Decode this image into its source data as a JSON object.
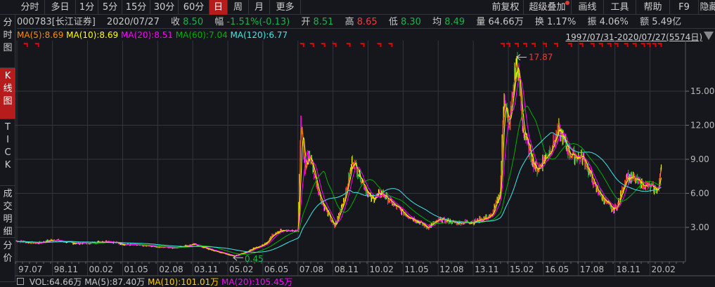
{
  "toolbar": {
    "periods": [
      "分时",
      "多日",
      "1分",
      "5分",
      "15分",
      "30分",
      "60分",
      "日",
      "周",
      "月",
      "更多"
    ],
    "active": "日",
    "right": [
      "前复权",
      "超级叠加",
      "画线",
      "工具",
      "帮助",
      "F9",
      "隐藏"
    ]
  },
  "sidebar": {
    "tabs": [
      "分\n时\n图",
      "K\n线\n图",
      "T\nI\nC\nK",
      "成\n交\n明\n细",
      "分\n价"
    ],
    "active": 1
  },
  "info": {
    "code": "000783[长江证券]",
    "date": "2020/07/27",
    "close_label": "收",
    "close": "8.50",
    "change_label": "幅",
    "change": "-1.51%(-0.13)",
    "open_label": "开",
    "open": "8.51",
    "high_label": "高",
    "high": "8.65",
    "low_label": "低",
    "low": "8.30",
    "avg_label": "均",
    "avg": "8.49",
    "vol_label": "量",
    "vol": "64.66万",
    "turnover_label": "换",
    "turnover": "1.17%",
    "amp_label": "振",
    "amp": "4.06%",
    "amount_label": "额",
    "amount": "5.49亿"
  },
  "ma": {
    "ma5": "MA(5):8.69",
    "ma10": "MA(10):8.69",
    "ma20": "MA(20):8.51",
    "ma60": "MA(60):7.04",
    "ma120": "MA(120):6.77"
  },
  "range": "1997/07/31-2020/07/27(5574日)",
  "vol_row": {
    "vol": "VOL:64.66万",
    "ma5": "MA(5):87.40万",
    "ma10": "MA(10):101.01万",
    "ma20": "MA(20):105.45万"
  },
  "colors": {
    "up": "#f23a3a",
    "down": "#19b34a",
    "ma5": "#ff8c00",
    "ma10": "#ffff00",
    "ma20": "#ff00ff",
    "ma60": "#00b000",
    "ma120": "#40e8e8",
    "accent": "#b71c1c"
  },
  "chart_data": {
    "type": "candlestick",
    "y_ticks": [
      "15.00",
      "12.00",
      "9.00",
      "6.00",
      "3.00"
    ],
    "ylim": [
      0,
      18.5
    ],
    "x_ticks": [
      "97.07",
      "98.11",
      "00.02",
      "01.05",
      "02.08",
      "03.11",
      "05.02",
      "06.05",
      "07.08",
      "08.11",
      "10.02",
      "11.05",
      "12.08",
      "13.11",
      "15.02",
      "16.05",
      "17.08",
      "18.11",
      "20.02"
    ],
    "price_path": [
      [
        1997.55,
        1.8
      ],
      [
        1998.3,
        1.6
      ],
      [
        1998.9,
        1.9
      ],
      [
        1999.6,
        1.6
      ],
      [
        2000.2,
        1.6
      ],
      [
        2000.8,
        1.8
      ],
      [
        2001.4,
        1.5
      ],
      [
        2002.0,
        1.4
      ],
      [
        2002.6,
        1.3
      ],
      [
        2003.2,
        1.2
      ],
      [
        2003.9,
        1.5
      ],
      [
        2004.5,
        1.0
      ],
      [
        2005.1,
        0.6
      ],
      [
        2005.3,
        0.45
      ],
      [
        2005.8,
        0.9
      ],
      [
        2006.4,
        1.5
      ],
      [
        2006.8,
        2.6
      ],
      [
        2007.0,
        2.7
      ],
      [
        2007.6,
        2.7
      ],
      [
        2007.7,
        12.5
      ],
      [
        2007.85,
        8.0
      ],
      [
        2008.0,
        9.5
      ],
      [
        2008.4,
        5.5
      ],
      [
        2008.9,
        3.0
      ],
      [
        2009.3,
        6.0
      ],
      [
        2009.55,
        9.0
      ],
      [
        2009.9,
        7.0
      ],
      [
        2010.2,
        5.5
      ],
      [
        2010.6,
        6.0
      ],
      [
        2011.0,
        5.0
      ],
      [
        2011.4,
        4.2
      ],
      [
        2011.9,
        3.5
      ],
      [
        2012.2,
        3.0
      ],
      [
        2012.7,
        3.7
      ],
      [
        2013.2,
        3.4
      ],
      [
        2013.9,
        3.5
      ],
      [
        2014.5,
        4.0
      ],
      [
        2014.8,
        6.0
      ],
      [
        2014.95,
        15.0
      ],
      [
        2015.1,
        11.5
      ],
      [
        2015.4,
        17.87
      ],
      [
        2015.6,
        12.0
      ],
      [
        2015.8,
        10.0
      ],
      [
        2016.1,
        8.0
      ],
      [
        2016.5,
        9.5
      ],
      [
        2016.9,
        11.5
      ],
      [
        2017.3,
        9.5
      ],
      [
        2017.8,
        9.0
      ],
      [
        2018.2,
        6.5
      ],
      [
        2018.8,
        4.5
      ],
      [
        2019.0,
        5.0
      ],
      [
        2019.3,
        7.5
      ],
      [
        2019.6,
        7.2
      ],
      [
        2019.9,
        6.8
      ],
      [
        2020.2,
        6.5
      ],
      [
        2020.45,
        6.3
      ],
      [
        2020.57,
        9.5
      ]
    ],
    "annotations": {
      "max": "17.87",
      "min": "0.45"
    },
    "markers": [
      1997.9,
      1998.3,
      2007.75,
      2008.1,
      2008.5,
      2008.9,
      2009.4,
      2009.9,
      2010.5,
      2010.9,
      2014.9,
      2015.1,
      2015.4,
      2015.7,
      2016.0,
      2016.4,
      2016.8,
      2017.3,
      2017.7,
      2018.1,
      2018.4,
      2018.7,
      2018.95,
      2019.3,
      2019.6,
      2019.9,
      2020.1,
      2020.3,
      2020.5
    ]
  }
}
